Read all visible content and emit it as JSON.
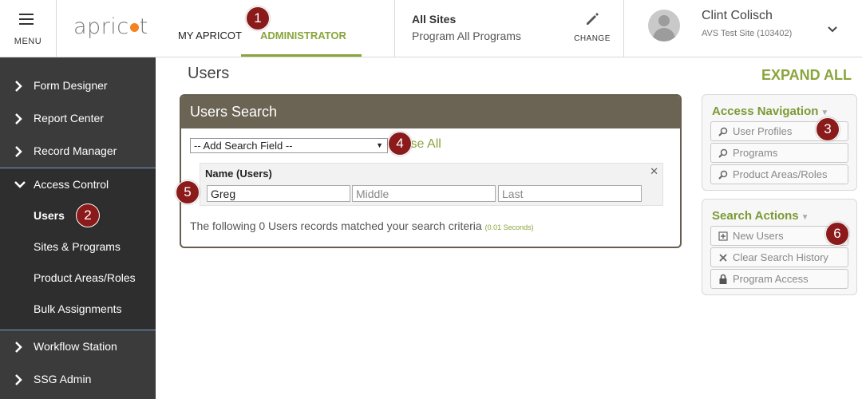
{
  "header": {
    "menu_label": "MENU",
    "logo_text_before": "apric",
    "logo_text_after": "t",
    "tabs": [
      {
        "label": "MY APRICOT"
      },
      {
        "label": "ADMINISTRATOR"
      }
    ],
    "sites_title": "All Sites",
    "sites_sub": "Program All Programs",
    "change_label": "CHANGE",
    "user_name": "Clint Colisch",
    "user_site": "AVS Test Site (103402)",
    "accent_color": "#8aa53c"
  },
  "sidebar": {
    "items": [
      {
        "label": "Form Designer"
      },
      {
        "label": "Report Center"
      },
      {
        "label": "Record Manager"
      },
      {
        "label": "Access Control"
      },
      {
        "label": "Workflow Station"
      },
      {
        "label": "SSG Admin"
      }
    ],
    "sub_items": [
      {
        "label": "Users"
      },
      {
        "label": "Sites & Programs"
      },
      {
        "label": "Product Areas/Roles"
      },
      {
        "label": "Bulk Assignments"
      }
    ]
  },
  "main": {
    "page_title": "Users",
    "expand_all": "EXPAND ALL",
    "panel_title": "Users Search",
    "search_select": "-- Add Search Field --",
    "browse_all": "Browse All",
    "browse_visible": "wse All",
    "name_label": "Name (Users)",
    "first_value": "Greg",
    "middle_placeholder": "Middle",
    "last_placeholder": "Last",
    "result_text": "The following 0 Users records matched your search criteria",
    "result_time": "(0.01 Seconds)"
  },
  "access_nav": {
    "title": "Access Navigation",
    "buttons": [
      {
        "label": "User Profiles",
        "icon": "search-icon"
      },
      {
        "label": "Programs",
        "icon": "search-icon"
      },
      {
        "label": "Product Areas/Roles",
        "icon": "search-icon"
      }
    ]
  },
  "search_actions": {
    "title": "Search Actions",
    "buttons": [
      {
        "label": "New Users",
        "icon": "add-icon"
      },
      {
        "label": "Clear Search History",
        "icon": "close-icon"
      },
      {
        "label": "Program Access",
        "icon": "lock-icon"
      }
    ]
  },
  "markers": [
    "1",
    "2",
    "3",
    "4",
    "5",
    "6"
  ]
}
